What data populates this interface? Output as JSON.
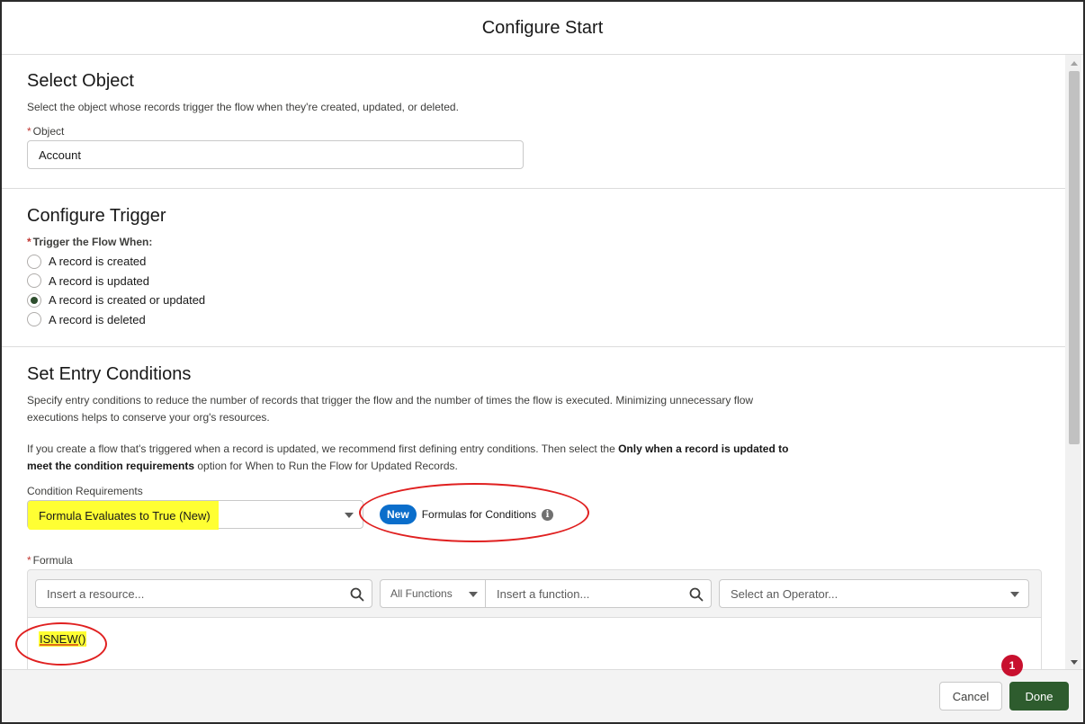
{
  "modal": {
    "title": "Configure Start"
  },
  "select_object": {
    "title": "Select Object",
    "help": "Select the object whose records trigger the flow when they're created, updated, or deleted.",
    "field_label": "Object",
    "value": "Account"
  },
  "configure_trigger": {
    "title": "Configure Trigger",
    "field_label": "Trigger the Flow When:",
    "options": [
      {
        "label": "A record is created",
        "checked": false
      },
      {
        "label": "A record is updated",
        "checked": false
      },
      {
        "label": "A record is created or updated",
        "checked": true
      },
      {
        "label": "A record is deleted",
        "checked": false
      }
    ]
  },
  "entry_conditions": {
    "title": "Set Entry Conditions",
    "help1": "Specify entry conditions to reduce the number of records that trigger the flow and the number of times the flow is executed. Minimizing unnecessary flow executions helps to conserve your org's resources.",
    "help2_prefix": "If you create a flow that's triggered when a record is updated, we recommend first defining entry conditions. Then select the ",
    "help2_bold": "Only when a record is updated to meet the condition requirements",
    "help2_suffix": " option for When to Run the Flow for Updated Records.",
    "condition_label": "Condition Requirements",
    "condition_value": "Formula Evaluates to True (New)",
    "new_badge": "New",
    "new_feature_text": "Formulas for Conditions",
    "formula_label": "Formula",
    "resource_placeholder": "Insert a resource...",
    "functions_select": "All Functions",
    "function_placeholder": "Insert a function...",
    "operator_placeholder": "Select an Operator...",
    "formula_text": "ISNEW()"
  },
  "footer": {
    "cancel_label": "Cancel",
    "done_label": "Done",
    "step_number": "1"
  },
  "colors": {
    "highlight": "#ffff33",
    "annotation": "#e02020",
    "brand_blue": "#0b6ecb",
    "done_green": "#2e5c2e"
  }
}
